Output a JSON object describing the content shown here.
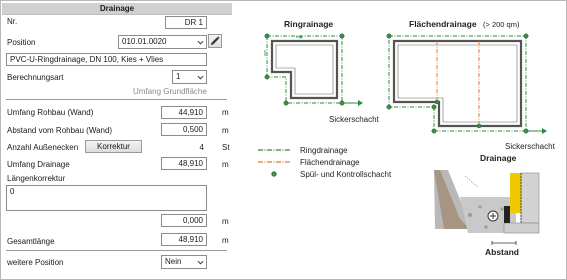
{
  "header": {
    "title": "Drainage"
  },
  "form": {
    "nr_label": "Nr.",
    "nr_value": "DR 1",
    "position_label": "Position",
    "position_value": "010.01.0020",
    "description": "PVC-U-Ringdrainage, DN 100, Kies + Vlies",
    "berechnungsart_label": "Berechnungsart",
    "berechnungsart_value": "1",
    "umfang_grundflaeche": "Umfang Grundfläche",
    "umfang_rohbau_label": "Umfang Rohbau (Wand)",
    "umfang_rohbau_value": "44,910",
    "umfang_rohbau_unit": "m",
    "abstand_label": "Abstand vom Rohbau (Wand)",
    "abstand_value": "0,500",
    "abstand_unit": "m",
    "aussenecken_label": "Anzahl Außenecken",
    "korrektur_button": "Korrektur",
    "aussenecken_value": "4",
    "aussenecken_unit": "St",
    "umfang_drainage_label": "Umfang Drainage",
    "umfang_drainage_value": "48,910",
    "umfang_drainage_unit": "m",
    "laengenkorrektur_label": "Längenkorrektur",
    "laengenkorrektur_text": "0",
    "laengenkorrektur_value": "0,000",
    "laengenkorrektur_unit": "m",
    "gesamtlaenge_label": "Gesamtlänge",
    "gesamtlaenge_value": "48,910",
    "gesamtlaenge_unit": "m",
    "weitere_label": "weitere Position",
    "weitere_value": "Nein"
  },
  "diagram": {
    "ring_title": "Ringrainage",
    "flaeche_title": "Flächendrainage",
    "flaeche_note": "(> 200 qm)",
    "sickerschacht_1": "Sickerschacht",
    "sickerschacht_2": "Sickerschacht",
    "legend": {
      "ring": "Ringdrainage",
      "flaeche": "Flächendrainage",
      "schacht": "Spül- und Kontrollschacht"
    },
    "section_title": "Drainage",
    "abstand_label": "Abstand",
    "colors": {
      "green": "#2e8b3a",
      "orange": "#e07a2f",
      "wall": "#8c8c8c"
    }
  },
  "icons": {
    "edit": "pencil-icon",
    "dropdown": "chevron-down-icon"
  }
}
